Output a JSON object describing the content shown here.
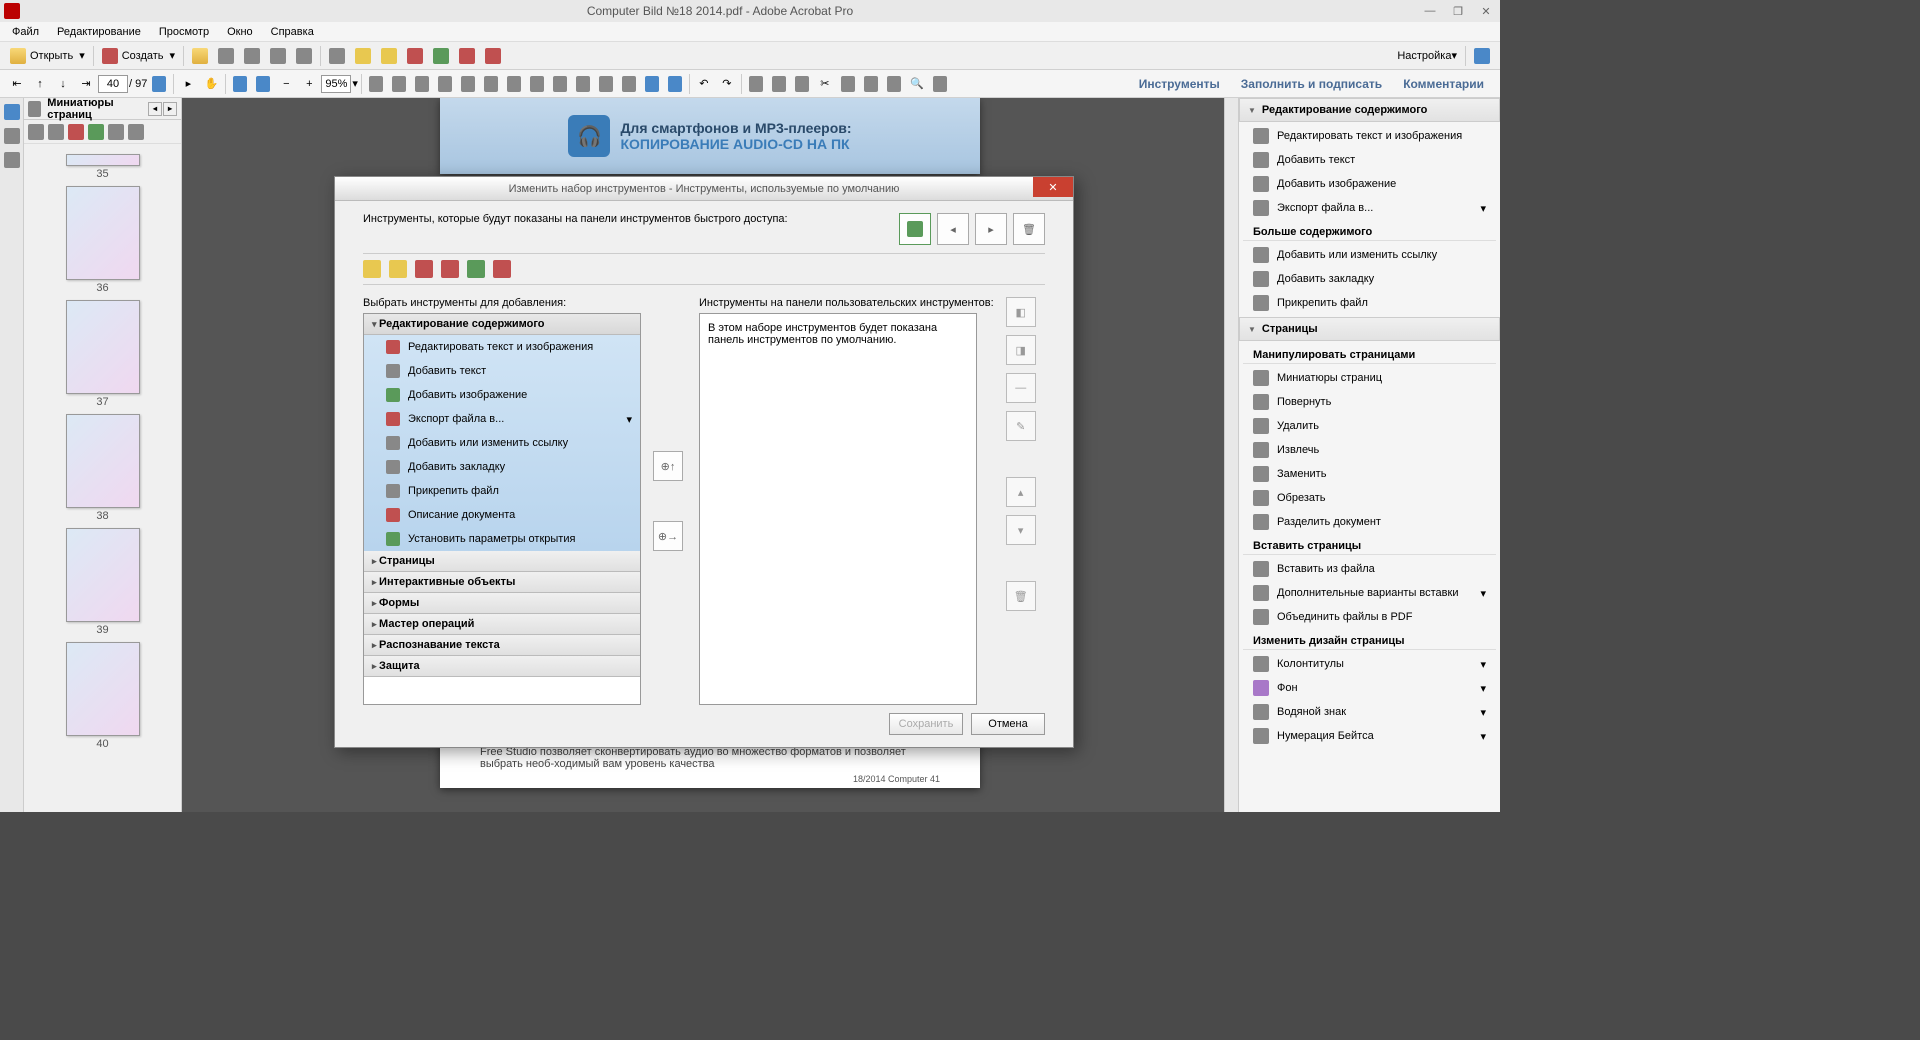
{
  "title": "Computer Bild №18 2014.pdf - Adobe Acrobat Pro",
  "menu": [
    "Файл",
    "Редактирование",
    "Просмотр",
    "Окно",
    "Справка"
  ],
  "toolbar1": {
    "open": "Открыть",
    "create": "Создать",
    "settings": "Настройка"
  },
  "nav": {
    "page": "40",
    "total": "/ 97",
    "zoom": "95%"
  },
  "tabs": {
    "tools": "Инструменты",
    "fill": "Заполнить и подписать",
    "comments": "Комментарии"
  },
  "thumbs": {
    "title": "Миниатюры страниц",
    "pages": [
      "35",
      "36",
      "37",
      "38",
      "39",
      "40"
    ]
  },
  "banner": {
    "l1": "Для смартфонов и МР3-плееров:",
    "l2": "КОПИРОВАНИЕ AUDIO-CD НА ПК"
  },
  "page2": {
    "body": "Free Studio позволяет сконвертировать аудио во множество форматов и позволяет выбрать необ-ходимый вам уровень качества",
    "foot": "18/2014   Computer   41"
  },
  "rp": {
    "sec1": "Редактирование содержимого",
    "items1": [
      "Редактировать текст и изображения",
      "Добавить текст",
      "Добавить изображение",
      "Экспорт файла в..."
    ],
    "more": "Больше содержимого",
    "items1b": [
      "Добавить или изменить ссылку",
      "Добавить закладку",
      "Прикрепить файл"
    ],
    "sec2": "Страницы",
    "sub1": "Манипулировать страницами",
    "items2": [
      "Миниатюры страниц",
      "Повернуть",
      "Удалить",
      "Извлечь",
      "Заменить",
      "Обрезать",
      "Разделить документ"
    ],
    "sub2": "Вставить страницы",
    "items3": [
      "Вставить из файла",
      "Дополнительные варианты вставки",
      "Объединить файлы в PDF"
    ],
    "sub3": "Изменить дизайн страницы",
    "items4": [
      "Колонтитулы",
      "Фон",
      "Водяной знак",
      "Нумерация Бейтса"
    ]
  },
  "dialog": {
    "title": "Изменить набор инструментов - Инструменты, используемые по умолчанию",
    "desc": "Инструменты, которые будут показаны на панели инструментов быстрого доступа:",
    "left_label": "Выбрать инструменты для добавления:",
    "right_label": "Инструменты на панели пользовательских инструментов:",
    "placeholder": "В этом наборе инструментов будет показана панель инструментов по умолчанию.",
    "cat1": "Редактирование содержимого",
    "leaves": [
      "Редактировать текст и изображения",
      "Добавить текст",
      "Добавить изображение",
      "Экспорт файла в...",
      "Добавить или изменить ссылку",
      "Добавить закладку",
      "Прикрепить файл",
      "Описание документа",
      "Установить параметры открытия"
    ],
    "cats": [
      "Страницы",
      "Интерактивные объекты",
      "Формы",
      "Мастер операций",
      "Распознавание текста",
      "Защита"
    ],
    "save": "Сохранить",
    "cancel": "Отмена"
  }
}
